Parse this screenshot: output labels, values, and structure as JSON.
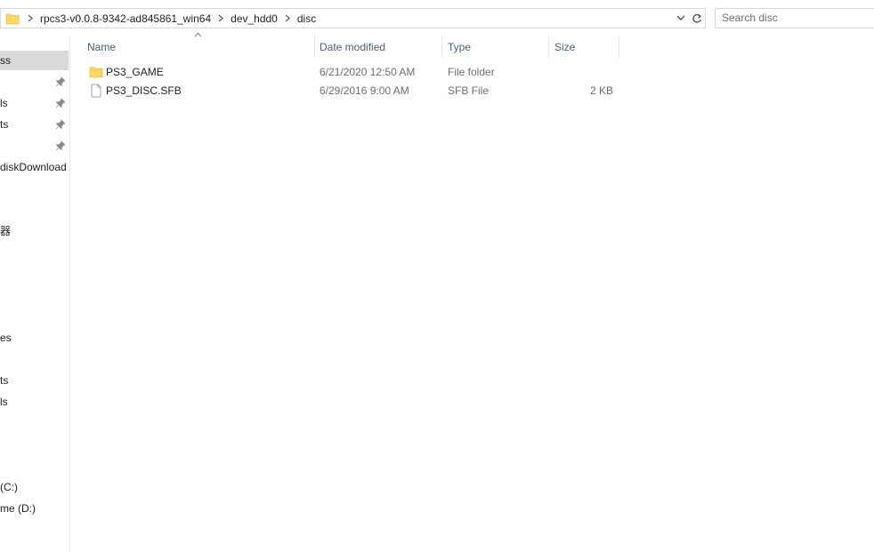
{
  "address_bar": {
    "crumbs": [
      "rpcs3-v0.0.8-9342-ad845861_win64",
      "dev_hdd0",
      "disc"
    ],
    "folder_icon": "folder-icon",
    "dropdown_icon": "chevron-down-icon"
  },
  "refresh_icon": "refresh-icon",
  "search": {
    "placeholder": "Search disc"
  },
  "nav_pane": {
    "items": [
      {
        "label": "ss",
        "pinned": false,
        "selected": true
      },
      {
        "label": "",
        "pinned": true
      },
      {
        "label": "ls",
        "pinned": true
      },
      {
        "label": "ts",
        "pinned": true
      },
      {
        "label": "",
        "pinned": true
      },
      {
        "label": "diskDownload",
        "pinned": false
      },
      {
        "label": "器",
        "pinned": false
      },
      {
        "label": "es",
        "pinned": false
      },
      {
        "label": "ts",
        "pinned": false
      },
      {
        "label": "ls",
        "pinned": false
      },
      {
        "label": "(C:)",
        "pinned": false
      },
      {
        "label": "me (D:)",
        "pinned": false
      }
    ]
  },
  "columns": {
    "name": "Name",
    "date_modified": "Date modified",
    "type": "Type",
    "size": "Size"
  },
  "files": [
    {
      "name": "PS3_GAME",
      "date_modified": "6/21/2020 12:50 AM",
      "type": "File folder",
      "size": "",
      "icon": "folder-icon"
    },
    {
      "name": "PS3_DISC.SFB",
      "date_modified": "6/29/2016 9:00 AM",
      "type": "SFB File",
      "size": "2 KB",
      "icon": "file-icon"
    }
  ],
  "colors": {
    "header_text": "#4c607a",
    "secondary_text": "#6d6d6d",
    "selection": "#d9d9d9",
    "folder_yellow": "#ffd764"
  }
}
